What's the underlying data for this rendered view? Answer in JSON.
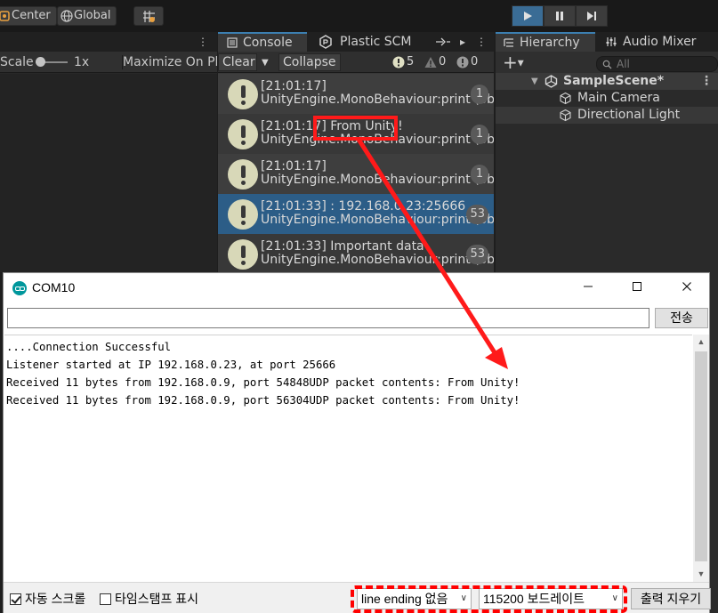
{
  "unity": {
    "toolbar": {
      "pivot_label": "Center",
      "global_label": "Global"
    },
    "scene_panel": {
      "scale_label": "Scale",
      "scale_value": "1x",
      "maximize_label": "Maximize On Pla"
    },
    "console": {
      "tabs": [
        "Console",
        "Plastic SCM"
      ],
      "clear_label": "Clear",
      "collapse_label": "Collapse",
      "info_count": "5",
      "warning_count": "0",
      "error_count": "0",
      "rows": [
        {
          "line1": "[21:01:17]",
          "line2": "UnityEngine.MonoBehaviour:print (object)",
          "count": "1"
        },
        {
          "line1": "[21:01:17] From Unity!",
          "line2": "UnityEngine.MonoBehaviour:print (object)",
          "count": "1"
        },
        {
          "line1": "[21:01:17]",
          "line2": "UnityEngine.MonoBehaviour:print (object)",
          "count": "1"
        },
        {
          "line1": "[21:01:33]      : 192.168.0.23:25666",
          "line2": "UnityEngine.MonoBehaviour:print (object)",
          "count": "53"
        },
        {
          "line1": "[21:01:33] Important data",
          "line2": "UnityEngine.MonoBehaviour:print (object)",
          "count": "53"
        }
      ]
    },
    "hierarchy": {
      "tabs": [
        "Hierarchy",
        "Audio Mixer"
      ],
      "search_placeholder": "All",
      "scene_name": "SampleScene*",
      "objects": [
        "Main Camera",
        "Directional Light"
      ]
    }
  },
  "serial_monitor": {
    "title": "COM10",
    "send_label": "전송",
    "input_value": "",
    "output_lines": [
      "....Connection Successful",
      "Listener started at IP 192.168.0.23, at port 25666",
      "Received 11 bytes from 192.168.0.9, port 54848UDP packet contents: From Unity!",
      "Received 11 bytes from 192.168.0.9, port 56304UDP packet contents: From Unity!"
    ],
    "autoscroll_label": "자동 스크롤",
    "autoscroll_checked": true,
    "timestamp_label": "타임스탬프 표시",
    "timestamp_checked": false,
    "line_ending": "line ending 없음",
    "baud_rate": "115200 보드레이트",
    "clear_output_label": "출력 지우기"
  },
  "colors": {
    "annotation_red": "#ff1a1a",
    "unity_selection": "#2c5d87",
    "arduino_teal": "#00979c"
  }
}
